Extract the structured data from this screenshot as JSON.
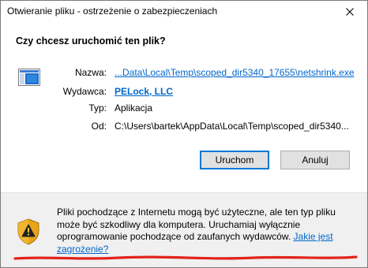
{
  "window": {
    "title": "Otwieranie pliku - ostrzeżenie o zabezpieczeniach"
  },
  "question": "Czy chcesz uruchomić ten plik?",
  "properties": {
    "name_label": "Nazwa:",
    "name_value": "...Data\\Local\\Temp\\scoped_dir5340_17655\\netshrink.exe",
    "publisher_label": "Wydawca:",
    "publisher_value": "PELock, LLC",
    "type_label": "Typ:",
    "type_value": "Aplikacja",
    "from_label": "Od:",
    "from_value": "C:\\Users\\bartek\\AppData\\Local\\Temp\\scoped_dir5340..."
  },
  "buttons": {
    "run": "Uruchom",
    "cancel": "Anuluj"
  },
  "warning": {
    "text": "Pliki pochodzące z Internetu mogą być użyteczne, ale ten typ pliku może być szkodliwy dla komputera. Uruchamiaj wyłącznie oprogramowanie pochodzące od zaufanych wydawców. ",
    "link": "Jakie jest zagrożenie?"
  },
  "colors": {
    "link": "#0066cc",
    "default_button_border": "#0078d7",
    "annotation": "#e2231a",
    "shield": "#e8a317"
  },
  "icons": {
    "file": "application-file-icon",
    "warning": "warning-shield-icon",
    "close": "close-icon"
  }
}
